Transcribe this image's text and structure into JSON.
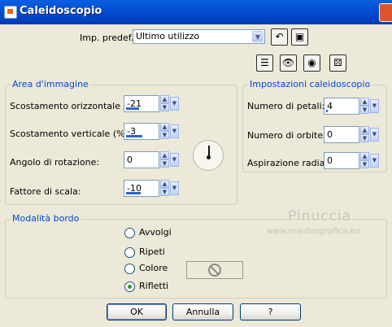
{
  "window": {
    "title": "Caleidoscopio"
  },
  "preset": {
    "label": "Imp. predef.:",
    "value": "Ultimo utilizzo"
  },
  "toolbar_icons": [
    "reset-icon",
    "save-icon",
    "toggle-preview-icon",
    "proof-icon",
    "hide-preview-icon",
    "random-icon"
  ],
  "area": {
    "title": "Area d'immagine",
    "h_offset": {
      "label": "Scostamento orizzontale (%):",
      "value": "-21",
      "level": 0.4
    },
    "v_offset": {
      "label": "Scostamento verticale (%):",
      "value": "-3",
      "level": 0.49
    },
    "rotation": {
      "label": "Angolo di rotazione:",
      "value": "0"
    },
    "scale": {
      "label": "Fattore di scala:",
      "value": "-10",
      "level": 0.45
    }
  },
  "kaleido": {
    "title": "Impostazioni caleidoscopio",
    "petals": {
      "label": "Numero di petali:",
      "value": "4",
      "level": 0.05
    },
    "orbits": {
      "label": "Numero di orbite:",
      "value": "0"
    },
    "suction": {
      "label": "Aspirazione radiale:",
      "value": "0"
    }
  },
  "border": {
    "title": "Modalità bordo",
    "options": [
      {
        "label": "Avvolgi",
        "selected": false
      },
      {
        "label": "Ripeti",
        "selected": false
      },
      {
        "label": "Colore",
        "selected": false
      },
      {
        "label": "Rifletti",
        "selected": true
      }
    ]
  },
  "watermark": {
    "name": "Pinuccia",
    "url": "www.maidiregrafica.eu"
  },
  "buttons": {
    "ok": "OK",
    "cancel": "Annulla",
    "help": "?"
  },
  "colors": {
    "titlebar": "#0453d8",
    "group_title": "#0046d5",
    "slider_fill": "#3163c5",
    "radio_dot": "#21a121"
  }
}
